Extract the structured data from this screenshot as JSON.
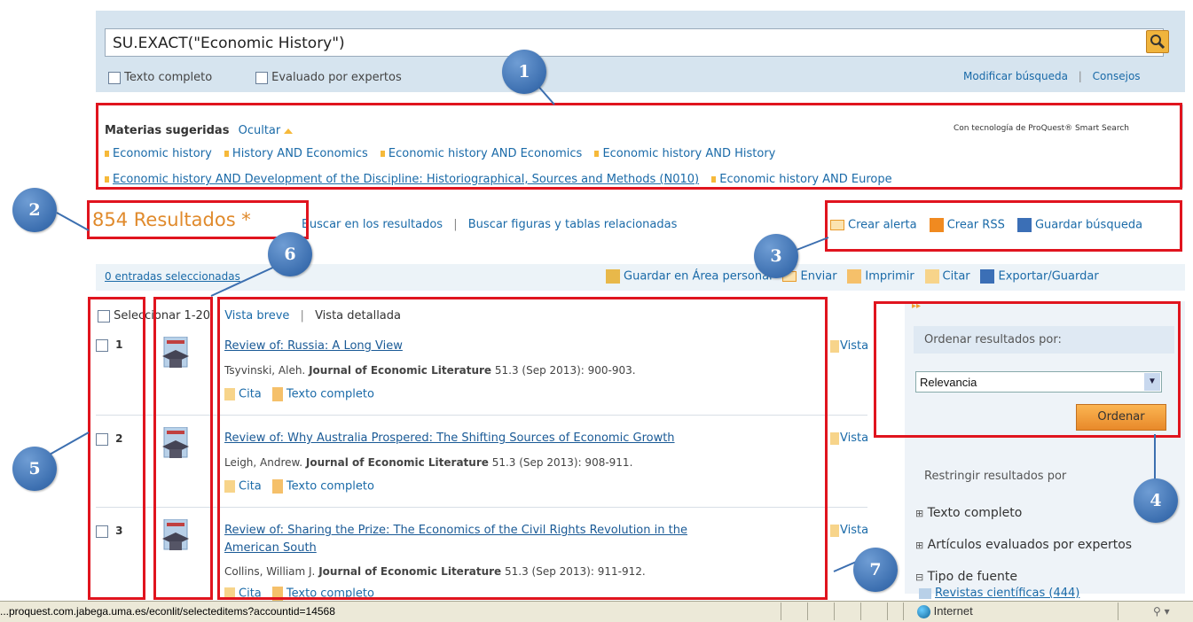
{
  "search": {
    "query": "SU.EXACT(\"Economic History\")",
    "fulltext_label": "Texto completo",
    "peer_label": "Evaluado por expertos",
    "modify_label": "Modificar búsqueda",
    "sep": "|",
    "tips_label": "Consejos"
  },
  "suggested": {
    "title": "Materias sugeridas",
    "hide_label": "Ocultar",
    "powered": "Con tecnología de ProQuest® Smart Search",
    "row1": [
      "Economic history",
      "History AND Economics",
      "Economic history AND Economics",
      "Economic history AND History"
    ],
    "row2": [
      "Economic history AND Development of the Discipline: Historiographical, Sources and Methods (N010)",
      "Economic history AND Europe"
    ]
  },
  "results": {
    "count_label": "854 Resultados *",
    "search_within": "Buscar en los resultados",
    "sep": "|",
    "figures": "Buscar figuras y tablas relacionadas",
    "alert": "Crear alerta",
    "rss": "Crear RSS",
    "save": "Guardar búsqueda"
  },
  "toolbar": {
    "selected": "0 entradas seleccionadas",
    "save_area": "Guardar en Área personal",
    "send": "Enviar",
    "print": "Imprimir",
    "cite": "Citar",
    "export": "Exportar/Guardar"
  },
  "listhead": {
    "select_all": "Seleccionar 1-20",
    "brief": "Vista breve",
    "sep": "|",
    "detailed": "Vista detallada"
  },
  "items": [
    {
      "num": "1",
      "title": "Review of: Russia: A Long View",
      "author": "Tsyvinski, Aleh.",
      "journal": "Journal of Economic Literature",
      "cite": "51.3  (Sep 2013): 900-903.",
      "cita": "Cita",
      "full": "Texto completo",
      "view": "Vista"
    },
    {
      "num": "2",
      "title": "Review of: Why Australia Prospered: The Shifting Sources of Economic Growth",
      "author": "Leigh, Andrew.",
      "journal": "Journal of Economic Literature",
      "cite": "51.3  (Sep 2013): 908-911.",
      "cita": "Cita",
      "full": "Texto completo",
      "view": "Vista"
    },
    {
      "num": "3",
      "title": "Review of: Sharing the Prize: The Economics of the Civil Rights Revolution in the",
      "title2": "American South",
      "author": "Collins, William J.",
      "journal": "Journal of Economic Literature",
      "cite": "51.3  (Sep 2013): 911-912.",
      "cita": "Cita",
      "full": "Texto completo",
      "view": "Vista"
    }
  ],
  "sort": {
    "label": "Ordenar resultados por:",
    "value": "Relevancia",
    "button": "Ordenar"
  },
  "filters": {
    "title": "Restringir resultados por",
    "f1": "Texto completo",
    "f2": "Artículos evaluados por expertos",
    "f3": "Tipo de fuente",
    "f3sub": "Revistas científicas (444)"
  },
  "status": {
    "url": "...proquest.com.jabega.uma.es/econlit/selecteditems?accountid=14568",
    "zone": "Internet"
  },
  "callouts": [
    "1",
    "2",
    "3",
    "4",
    "5",
    "6",
    "7"
  ],
  "colors": {
    "highlight": "#e0141e",
    "callout": "#3c6fb0",
    "link": "#1a6aa8",
    "results_count": "#e08a2c"
  }
}
